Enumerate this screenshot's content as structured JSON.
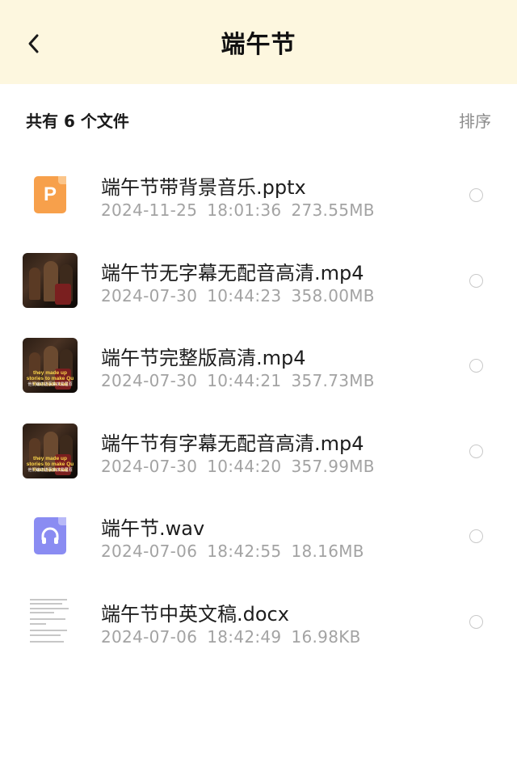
{
  "header": {
    "title": "端午节",
    "back_icon": "chevron-left-icon"
  },
  "toolbar": {
    "file_count": "共有 6 个文件",
    "sort_label": "排序"
  },
  "files": [
    {
      "name": "端午节带背景音乐.pptx",
      "date": "2024-11-25",
      "time": "18:01:36",
      "size": "273.55MB",
      "type": "pptx",
      "icon": "ppt-icon",
      "icon_letter": "P"
    },
    {
      "name": "端午节无字幕无配音高清.mp4",
      "date": "2024-07-30",
      "time": "10:44:23",
      "size": "358.00MB",
      "type": "mp4",
      "icon": "video-thumbnail"
    },
    {
      "name": "端午节完整版高清.mp4",
      "date": "2024-07-30",
      "time": "10:44:21",
      "size": "357.73MB",
      "type": "mp4",
      "icon": "video-thumbnail",
      "thumb_caption": "they made up stories to make Qu Yuan look bad",
      "thumb_subcaption": "他们编造故事来抹黑屈原"
    },
    {
      "name": "端午节有字幕无配音高清.mp4",
      "date": "2024-07-30",
      "time": "10:44:20",
      "size": "357.99MB",
      "type": "mp4",
      "icon": "video-thumbnail",
      "thumb_caption": "they made up stories to make Qu Yuan look bad",
      "thumb_subcaption": "他们编造故事来抹黑屈原"
    },
    {
      "name": "端午节.wav",
      "date": "2024-07-06",
      "time": "18:42:55",
      "size": "18.16MB",
      "type": "wav",
      "icon": "audio-icon"
    },
    {
      "name": "端午节中英文稿.docx",
      "date": "2024-07-06",
      "time": "18:42:49",
      "size": "16.98KB",
      "type": "docx",
      "icon": "document-thumbnail"
    }
  ],
  "colors": {
    "header_bg": "#fdf7df",
    "ppt_orange": "#f7a04b",
    "audio_purple": "#8a8cf2",
    "meta_gray": "#a3a3a3"
  }
}
